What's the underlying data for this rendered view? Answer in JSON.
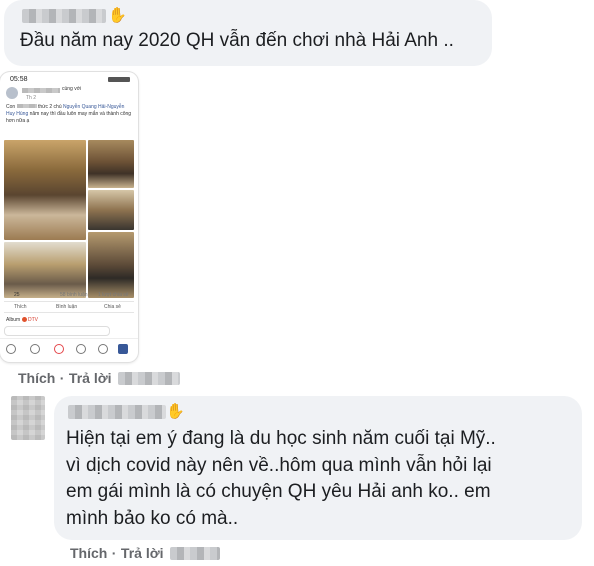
{
  "comment1": {
    "text": "Đầu năm nay 2020 QH vẫn đến chơi nhà Hải Anh .."
  },
  "phone_post": {
    "status_time": "05:58",
    "header": "cùng với",
    "time": "Th 2",
    "body_start": "Con",
    "body_mid": "thức 2 chú",
    "tag1": "Nguyễn Quang",
    "tag2": "Hải",
    "tag3": "Nguyễn Huy Hùng",
    "body_end": "năm nay thì đầu luôn may mắn và thành công hơn nữa ạ",
    "reaction_count": "25",
    "comments_count": "58 bình luận",
    "shares_count": "1 lượt chia sẻ",
    "like": "Thích",
    "comment": "Bình luận",
    "share": "Chia sẻ",
    "album": "Album",
    "album_badge": "DTV"
  },
  "actions1": {
    "like": "Thích",
    "separator": "·",
    "reply": "Trả lời"
  },
  "comment2": {
    "lines": [
      "Hiện tại em ý đang là du học sinh năm cuối tại Mỹ..",
      "vì dịch covid này nên về..hôm qua mình vẫn hỏi lại",
      "em gái mình là có chuyện QH yêu Hải anh ko.. em",
      "mình bảo ko có mà.."
    ]
  },
  "actions2": {
    "like": "Thích",
    "separator": "·",
    "reply": "Trả lời"
  },
  "icons": {
    "wave1": "wave-hand-icon",
    "wave2": "wave-hand-icon"
  }
}
